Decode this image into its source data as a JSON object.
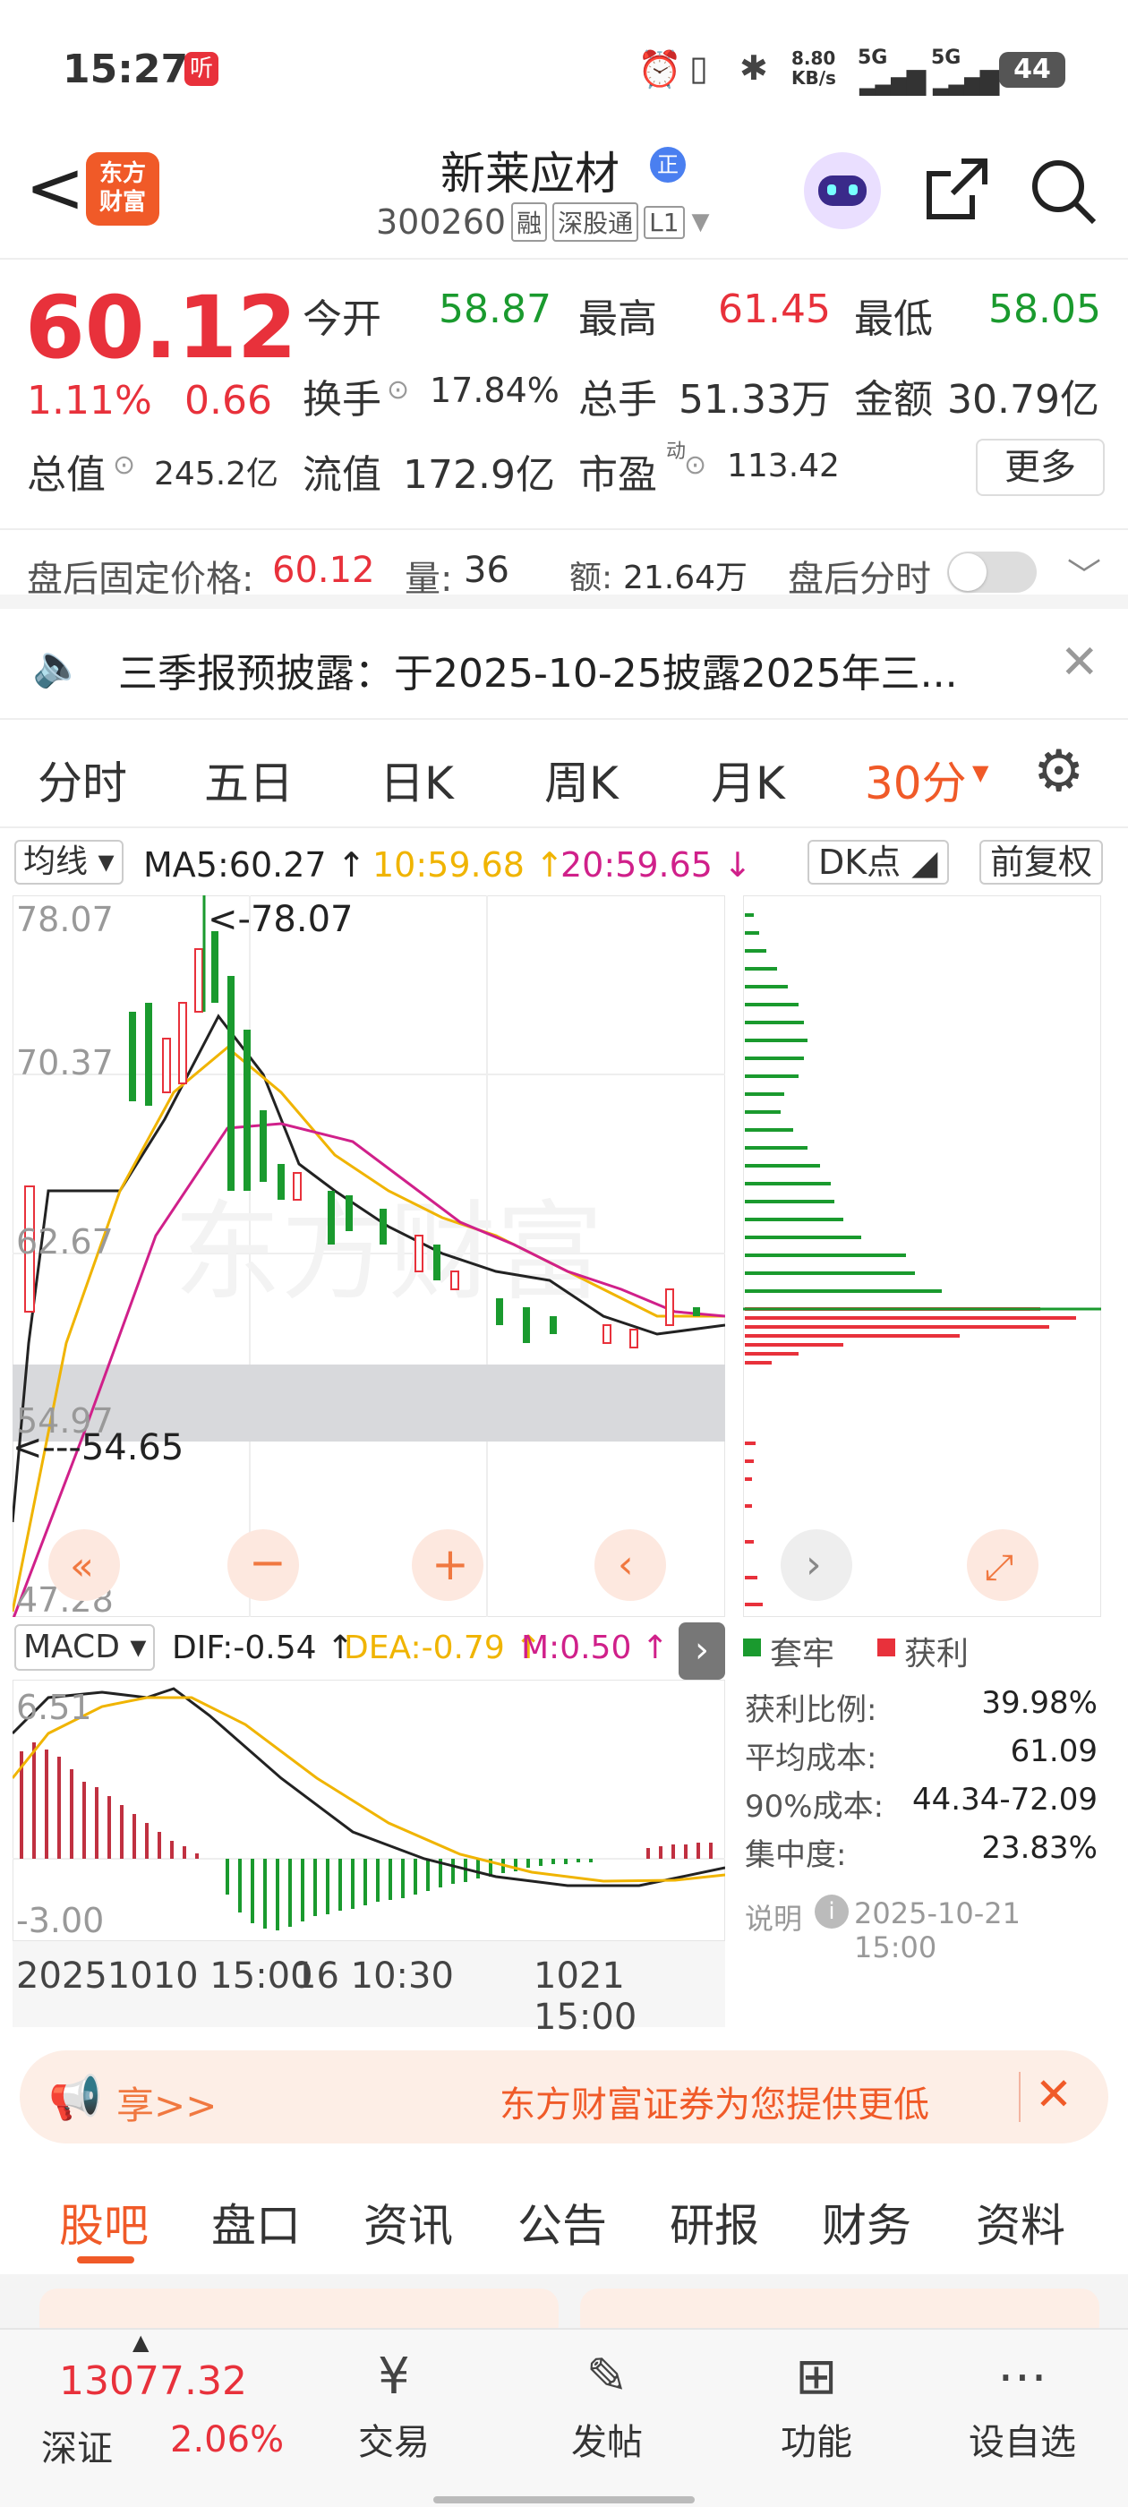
{
  "status_bar": {
    "time": "15:27",
    "speed": "8.80\nKB/s",
    "net1": "5G",
    "net2": "5G",
    "battery": "44"
  },
  "header": {
    "back": "<",
    "logo_line1": "东方",
    "logo_line2": "财富",
    "stock_name": "新莱应材",
    "badge": "正",
    "code": "300260",
    "tag1": "融",
    "tag2": "深股通",
    "tag3": "L1"
  },
  "quote": {
    "price": "60.12",
    "pct": "1.11%",
    "change": "0.66",
    "open_label": "今开",
    "open": "58.87",
    "high_label": "最高",
    "high": "61.45",
    "low_label": "最低",
    "low": "58.05",
    "turnover_label": "换手",
    "turnover": "17.84%",
    "volume_label": "总手",
    "volume": "51.33万",
    "amount_label": "金额",
    "amount": "30.79亿",
    "mktcap_label": "总值",
    "mktcap": "245.2亿",
    "float_label": "流值",
    "float": "172.9亿",
    "pe_label": "市盈",
    "pe_sup": "动",
    "pe": "113.42",
    "more": "更多"
  },
  "afterhours": {
    "fixed_label": "盘后固定价格:",
    "fixed_price": "60.12",
    "qty_label": "量:",
    "qty": "36",
    "amt_label": "额:",
    "amt": "21.64万",
    "toggle_label": "盘后分时"
  },
  "notice": {
    "text": "三季报预披露：于2025-10-25披露2025年三..."
  },
  "ktabs": [
    "分时",
    "五日",
    "日K",
    "周K",
    "月K",
    "30分"
  ],
  "ma": {
    "label": "均线",
    "ma5": "MA5:60.27 ↑",
    "ma10": "10:59.68 ↑",
    "ma20": "20:59.65 ↓",
    "dk": "DK点",
    "fq": "前复权"
  },
  "price_axis": {
    "p1": "78.07",
    "p2": "70.37",
    "p3": "62.67",
    "p4": "54.97",
    "p5": "47.28",
    "hi_mark": "<-78.07",
    "lo_mark": "<---54.65"
  },
  "macd": {
    "label": "MACD",
    "dif": "DIF:-0.54 ↑",
    "dea": "DEA:-0.79 ↑",
    "m": "M:0.50 ↑",
    "top": "6.51",
    "bottom": "-3.00"
  },
  "time_axis": {
    "t1": "20251010 15:00",
    "t2": "16 10:30",
    "t3": "1021 15:00"
  },
  "chip": {
    "legend1": "套牢",
    "legend2": "获利",
    "rows": [
      {
        "k": "获利比例:",
        "v": "39.98%"
      },
      {
        "k": "平均成本:",
        "v": "61.09"
      },
      {
        "k": "90%成本:",
        "v": "44.34-72.09"
      },
      {
        "k": "集中度:",
        "v": "23.83%"
      }
    ],
    "note_label": "说明",
    "note_time": "2025-10-21 15:00"
  },
  "banner": {
    "left": "享>>",
    "text": "东方财富证券为您提供更低"
  },
  "section_tabs": [
    "股吧",
    "盘口",
    "资讯",
    "公告",
    "研报",
    "财务",
    "资料"
  ],
  "bottom_nav": {
    "index_value": "13077.32",
    "index_name": "深证",
    "index_pct": "2.06%",
    "items": [
      "交易",
      "发帖",
      "功能",
      "设自选"
    ]
  },
  "colors": {
    "red": "#e8313b",
    "green": "#1a9a2e",
    "orange": "#f07840",
    "ma10": "#f0b400",
    "ma20": "#d0208a"
  }
}
